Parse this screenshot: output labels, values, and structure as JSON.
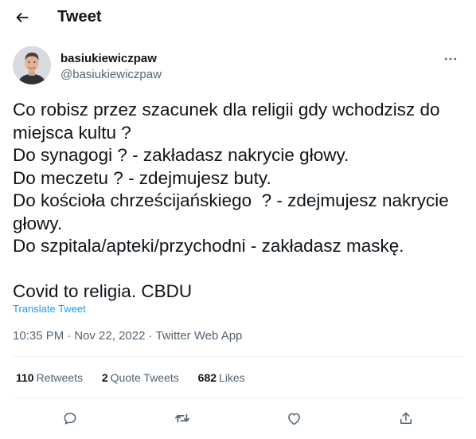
{
  "header": {
    "title": "Tweet"
  },
  "author": {
    "display_name": "basiukiewiczpaw",
    "handle": "@basiukiewiczpaw"
  },
  "tweet": {
    "lines": [
      "Co robisz przez szacunek dla religii gdy wchodzisz do",
      "miejsca kultu ?",
      "Do synagogi ? - zakładasz nakrycie głowy.",
      "Do meczetu ? - zdejmujesz buty.",
      "Do kościoła chrześcijańskiego  ? - zdejmujesz nakrycie",
      "głowy.",
      "Do szpitala/apteki/przychodni - zakładasz maskę.",
      "",
      "Covid to religia. CBDU"
    ],
    "translate_label": "Translate Tweet",
    "time": "10:35 PM",
    "date": "Nov 22, 2022",
    "source": "Twitter Web App",
    "separator": "·"
  },
  "stats": {
    "retweets": {
      "count": "110",
      "label": "Retweets"
    },
    "quote_tweets": {
      "count": "2",
      "label": "Quote Tweets"
    },
    "likes": {
      "count": "682",
      "label": "Likes"
    }
  },
  "icons": {
    "back": "arrow-left-icon",
    "more": "more-horizontal-icon",
    "reply": "reply-icon",
    "retweet": "retweet-icon",
    "like": "heart-icon",
    "share": "share-icon"
  },
  "colors": {
    "text": "#0f1419",
    "secondary": "#536471",
    "link": "#1d9bf0",
    "divider": "#eff3f4"
  }
}
